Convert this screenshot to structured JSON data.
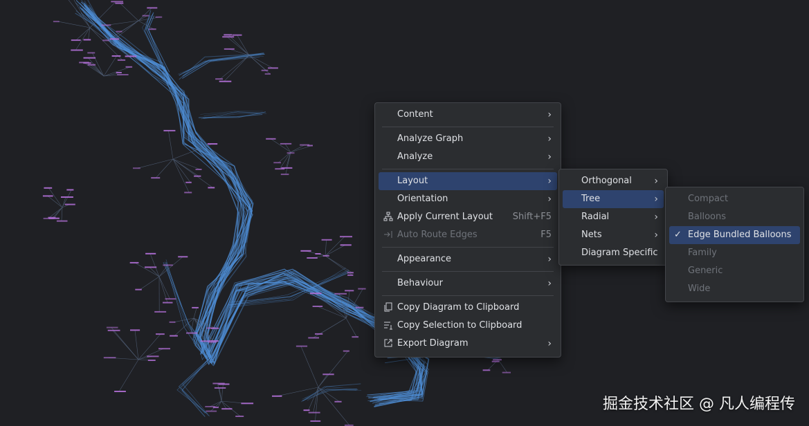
{
  "menu": {
    "content": "Content",
    "analyze_graph": "Analyze Graph",
    "analyze": "Analyze",
    "layout": "Layout",
    "orientation": "Orientation",
    "apply_current_layout": "Apply Current Layout",
    "apply_current_layout_shortcut": "Shift+F5",
    "auto_route_edges": "Auto Route Edges",
    "auto_route_edges_shortcut": "F5",
    "appearance": "Appearance",
    "behaviour": "Behaviour",
    "copy_diagram": "Copy Diagram to Clipboard",
    "copy_selection": "Copy Selection to Clipboard",
    "export_diagram": "Export Diagram"
  },
  "layout_submenu": {
    "orthogonal": "Orthogonal",
    "tree": "Tree",
    "radial": "Radial",
    "nets": "Nets",
    "diagram_specific": "Diagram Specific"
  },
  "tree_submenu": {
    "compact": "Compact",
    "balloons": "Balloons",
    "edge_bundled_balloons": "Edge Bundled Balloons",
    "family": "Family",
    "generic": "Generic",
    "wide": "Wide",
    "selected": "Edge Bundled Balloons"
  },
  "watermark": "掘金技术社区 @ 凡人编程传",
  "colors": {
    "background": "#1f2024",
    "edge": "#4f8fd8",
    "node": "#b16fd6",
    "selection": "#2e436e"
  }
}
